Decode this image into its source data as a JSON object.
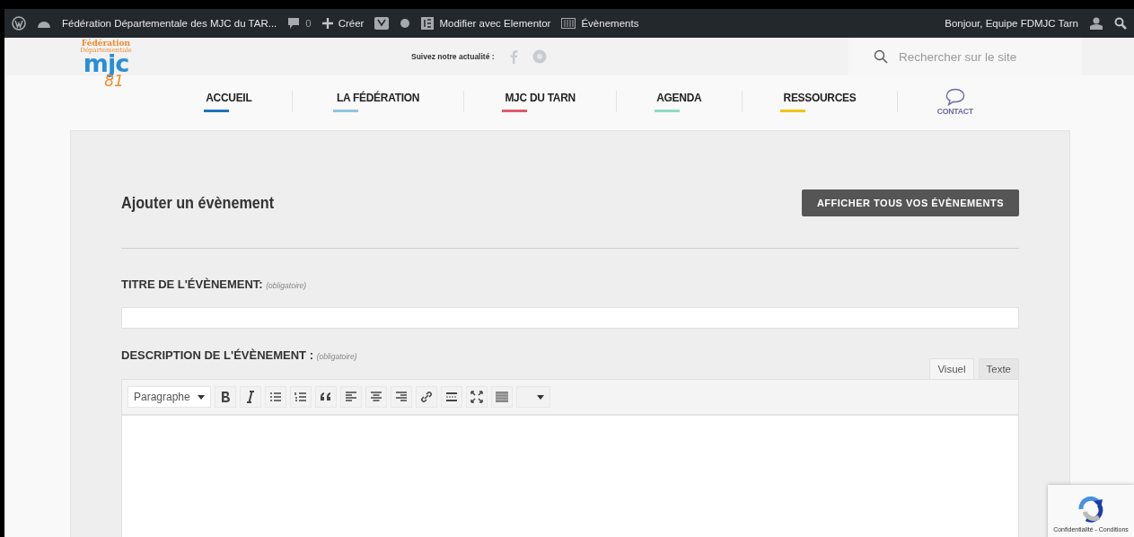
{
  "admin_bar": {
    "site_name": "Fédération Départementale des MJC du TAR...",
    "comments_count": "0",
    "create_label": "Créer",
    "elementor_label": "Modifier avec Elementor",
    "events_label": "Évènements",
    "greeting": "Bonjour, Equipe FDMJC Tarn"
  },
  "header": {
    "logo": {
      "line_1": "Fédération",
      "line_2": "Départementale",
      "main": "mjc",
      "number": "81"
    },
    "follow_label": "Suivez notre actualité :",
    "search": {
      "placeholder": "Rechercher sur le site"
    }
  },
  "nav": [
    {
      "label": "ACCUEIL",
      "color": "#1e73be",
      "kind": "text"
    },
    {
      "label": "LA FÉDÉRATION",
      "color": "#8ec5e0",
      "kind": "text"
    },
    {
      "label": "MJC DU TARN",
      "color": "#e05a6a",
      "kind": "text"
    },
    {
      "label": "AGENDA",
      "color": "#8fdcc5",
      "kind": "text"
    },
    {
      "label": "RESSOURCES",
      "color": "#f0c419",
      "kind": "text"
    },
    {
      "label": "CONTACT",
      "kind": "icon"
    }
  ],
  "form": {
    "title": "Ajouter un évènement",
    "show_all_button": "AFFICHER TOUS VOS ÉVÈNEMENTS",
    "fields": [
      {
        "label": "TITRE DE L'ÉVÈNEMENT:",
        "hint": "(obligatoire)",
        "kind": "input"
      },
      {
        "label": "DESCRIPTION DE L'ÉVÈNEMENT :",
        "hint": "(obligatoire)",
        "kind": "editor"
      }
    ],
    "editor_tabs": [
      {
        "label": "Visuel",
        "selected": true
      },
      {
        "label": "Texte",
        "selected": false
      }
    ],
    "format_select": "Paragraphe"
  },
  "recaptcha": {
    "caption": "Confidentialité - Conditions"
  }
}
